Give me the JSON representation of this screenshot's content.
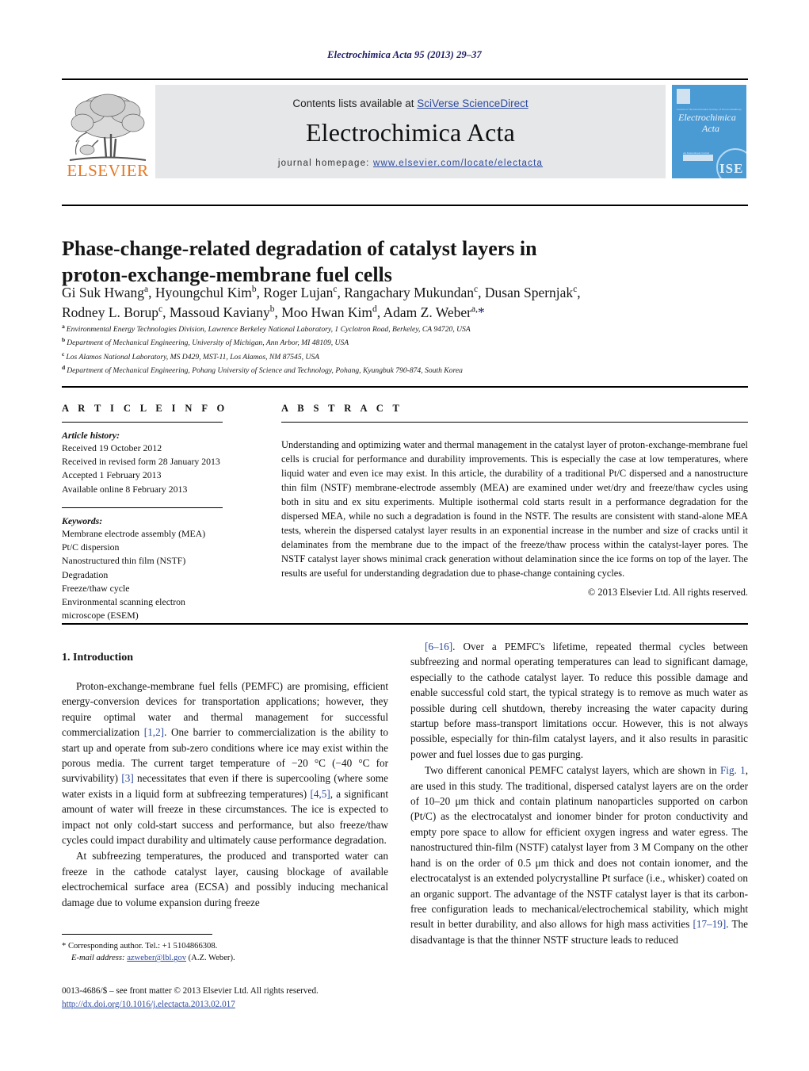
{
  "running_head": "Electrochimica Acta 95 (2013) 29–37",
  "header": {
    "contents_prefix": "Contents lists available at ",
    "sciencedirect_link": "SciVerse ScienceDirect",
    "journal_name": "Electrochimica Acta",
    "homepage_label": "journal homepage:",
    "homepage_url": "www.elsevier.com/locate/electacta",
    "publisher_logo_text": "ELSEVIER",
    "cover": {
      "tiny_top_text": "Journal of the International Society of Electrochemistry",
      "title_line1": "Electrochimica",
      "title_line2": "Acta",
      "chip_label": "An International Journal",
      "chip_text": "Selected papers",
      "society_mark": "ISE"
    }
  },
  "article": {
    "title_line1": "Phase-change-related degradation of catalyst layers in",
    "title_line2": "proton-exchange-membrane fuel cells",
    "authors_line1": "Gi Suk Hwang<sup>a</sup>, Hyoungchul Kim<sup>b</sup>, Roger Lujan<sup>c</sup>, Rangachary Mukundan<sup>c</sup>, Dusan Spernjak<sup>c</sup>,",
    "authors_line2": "Rodney L. Borup<sup>c</sup>, Massoud Kaviany<sup>b</sup>, Moo Hwan Kim<sup>d</sup>, Adam Z. Weber<sup>a,</sup><span class=\"star\">*</span>",
    "affiliations": [
      {
        "mark": "a",
        "text": "Environmental Energy Technologies Division, Lawrence Berkeley National Laboratory, 1 Cyclotron Road, Berkeley, CA 94720, USA"
      },
      {
        "mark": "b",
        "text": "Department of Mechanical Engineering, University of Michigan, Ann Arbor, MI 48109, USA"
      },
      {
        "mark": "c",
        "text": "Los Alamos National Laboratory, MS D429, MST-11, Los Alamos, NM 87545, USA"
      },
      {
        "mark": "d",
        "text": "Department of Mechanical Engineering, Pohang University of Science and Technology, Pohang, Kyungbuk 790-874, South Korea"
      }
    ]
  },
  "article_info": {
    "section_label": "A R T I C L E   I N F O",
    "history_title": "Article history:",
    "history": [
      "Received 19 October 2012",
      "Received in revised form 28 January 2013",
      "Accepted 1 February 2013",
      "Available online 8 February 2013"
    ],
    "keywords_title": "Keywords:",
    "keywords": [
      "Membrane electrode assembly (MEA)",
      "Pt/C dispersion",
      "Nanostructured thin film (NSTF)",
      "Degradation",
      "Freeze/thaw cycle",
      "Environmental scanning electron",
      "microscope (ESEM)"
    ]
  },
  "abstract": {
    "section_label": "A B S T R A C T",
    "text": "Understanding and optimizing water and thermal management in the catalyst layer of proton-exchange-membrane fuel cells is crucial for performance and durability improvements. This is especially the case at low temperatures, where liquid water and even ice may exist. In this article, the durability of a traditional Pt/C dispersed and a nanostructure thin film (NSTF) membrane-electrode assembly (MEA) are examined under wet/dry and freeze/thaw cycles using both in situ and ex situ experiments. Multiple isothermal cold starts result in a performance degradation for the dispersed MEA, while no such a degradation is found in the NSTF. The results are consistent with stand-alone MEA tests, wherein the dispersed catalyst layer results in an exponential increase in the number and size of cracks until it delaminates from the membrane due to the impact of the freeze/thaw process within the catalyst-layer pores. The NSTF catalyst layer shows minimal crack generation without delamination since the ice forms on top of the layer. The results are useful for understanding degradation due to phase-change containing cycles.",
    "copyright": "© 2013 Elsevier Ltd. All rights reserved."
  },
  "body": {
    "section_heading": "1.  Introduction",
    "left_paragraphs": [
      "Proton-exchange-membrane fuel fells (PEMFC) are promising, efficient energy-conversion devices for transportation applications; however, they require optimal water and thermal management for successful commercialization <span class=\"cite\">[1,2]</span>. One barrier to commercialization is the ability to start up and operate from sub-zero conditions where ice may exist within the porous media. The current target temperature of −20 °C (−40 °C for survivability) <span class=\"cite\">[3]</span> necessitates that even if there is supercooling (where some water exists in a liquid form at subfreezing temperatures) <span class=\"cite\">[4,5]</span>, a significant amount of water will freeze in these circumstances. The ice is expected to impact not only cold-start success and performance, but also freeze/thaw cycles could impact durability and ultimately cause performance degradation.",
      "At subfreezing temperatures, the produced and transported water can freeze in the cathode catalyst layer, causing blockage of available electrochemical surface area (ECSA) and possibly inducing mechanical damage due to volume expansion during freeze"
    ],
    "right_paragraphs": [
      "<span class=\"cite\">[6–16]</span>. Over a PEMFC's lifetime, repeated thermal cycles between subfreezing and normal operating temperatures can lead to significant damage, especially to the cathode catalyst layer. To reduce this possible damage and enable successful cold start, the typical strategy is to remove as much water as possible during cell shutdown, thereby increasing the water capacity during startup before mass-transport limitations occur. However, this is not always possible, especially for thin-film catalyst layers, and it also results in parasitic power and fuel losses due to gas purging.",
      "Two different canonical PEMFC catalyst layers, which are shown in <span class=\"cite\">Fig. 1</span>, are used in this study. The traditional, dispersed catalyst layers are on the order of 10–20 μm thick and contain platinum nanoparticles supported on carbon (Pt/C) as the electrocatalyst and ionomer binder for proton conductivity and empty pore space to allow for efficient oxygen ingress and water egress. The nanostructured thin-film (NSTF) catalyst layer from 3 M Company on the other hand is on the order of 0.5 μm thick and does not contain ionomer, and the electrocatalyst is an extended polycrystalline Pt surface (i.e., whisker) coated on an organic support. The advantage of the NSTF catalyst layer is that its carbon-free configuration leads to mechanical/electrochemical stability, which might result in better durability, and also allows for high mass activities <span class=\"cite\">[17–19]</span>. The disadvantage is that the thinner NSTF structure leads to reduced"
    ]
  },
  "footer": {
    "corresponding": "* Corresponding author. Tel.: +1 5104866308.",
    "email_label": "E-mail address:",
    "email": "azweber@lbl.gov",
    "email_suffix": "(A.Z. Weber).",
    "frontmatter": "0013-4686/$ – see front matter © 2013 Elsevier Ltd. All rights reserved.",
    "doi": "http://dx.doi.org/10.1016/j.electacta.2013.02.017"
  },
  "colors": {
    "link": "#2c4a9e",
    "running_head": "#1b1b63",
    "band_gray": "#e6e7e9",
    "cover_blue": "#4a9ad4",
    "elsevier_orange": "#e87722"
  }
}
